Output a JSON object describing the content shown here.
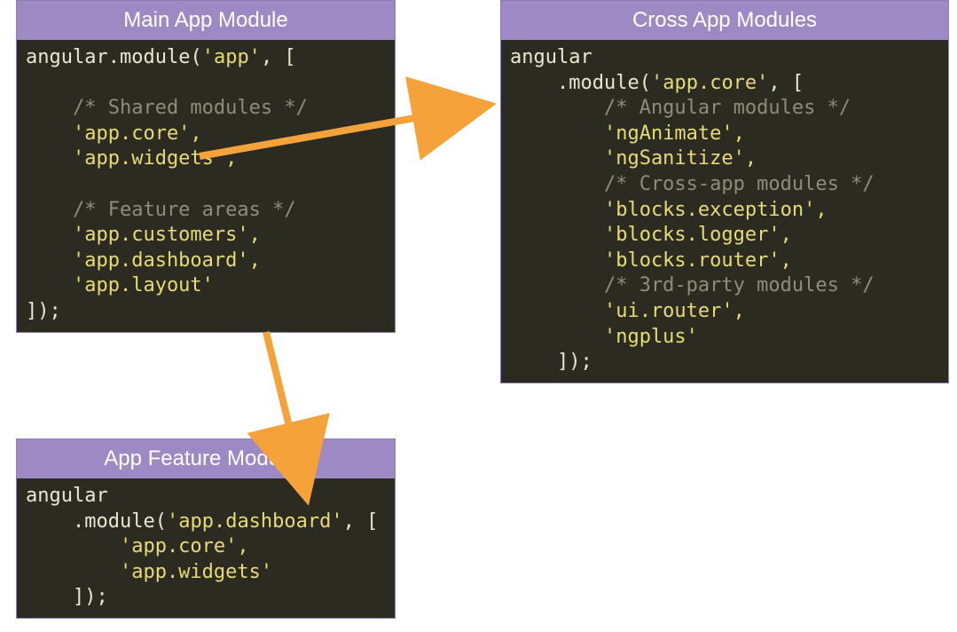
{
  "panels": {
    "main": {
      "title": "Main App Module",
      "l1_a": "angular",
      "l1_b": ".",
      "l1_c": "module",
      "l1_d": "(",
      "l1_e": "'app'",
      "l1_f": ", [",
      "c1": "    /* Shared modules */",
      "s1": "    'app.core',",
      "s2": "    'app.widgets',",
      "c2": "    /* Feature areas */",
      "s3": "    'app.customers',",
      "s4": "    'app.dashboard',",
      "s5": "    'app.layout'",
      "end": "]);"
    },
    "cross": {
      "title": "Cross App Modules",
      "l1": "angular",
      "l2_a": "    .",
      "l2_b": "module",
      "l2_c": "(",
      "l2_d": "'app.core'",
      "l2_e": ", [",
      "c1": "        /* Angular modules */",
      "s1": "        'ngAnimate',",
      "s2": "        'ngSanitize',",
      "c2": "        /* Cross-app modules */",
      "s3": "        'blocks.exception',",
      "s4": "        'blocks.logger',",
      "s5": "        'blocks.router',",
      "c3": "        /* 3rd-party modules */",
      "s6": "        'ui.router',",
      "s7": "        'ngplus'",
      "end": "    ]);"
    },
    "feature": {
      "title": "App Feature Modules",
      "l1": "angular",
      "l2_a": "    .",
      "l2_b": "module",
      "l2_c": "(",
      "l2_d": "'app.dashboard'",
      "l2_e": ", [",
      "s1": "        'app.core',",
      "s2": "        'app.widgets'",
      "end": "    ]);"
    }
  },
  "arrows": {
    "main_to_cross": {
      "from": "app.core in Main App Module",
      "to": "Cross App Modules panel"
    },
    "main_to_feature": {
      "from": "app.dashboard in Main App Module",
      "to": "App Feature Modules panel"
    }
  },
  "colors": {
    "header_bg": "#9d89c4",
    "code_bg": "#2b2b22",
    "string": "#e6db74",
    "comment": "#8d8d7a",
    "arrow": "#f5a23b"
  }
}
